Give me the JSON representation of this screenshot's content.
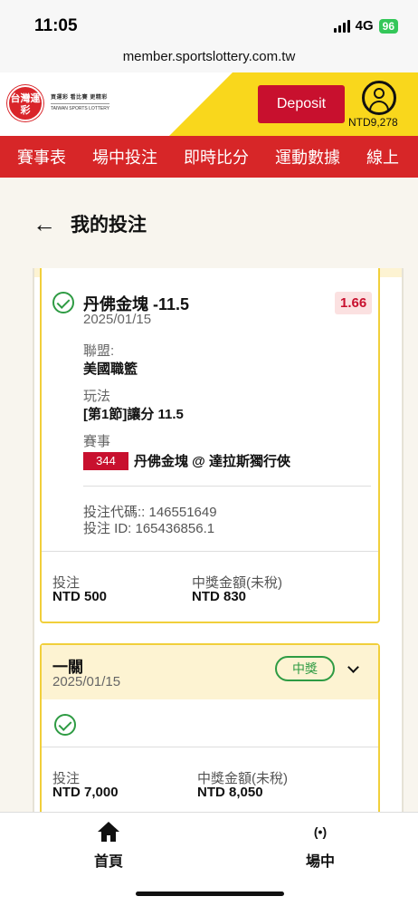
{
  "status_bar": {
    "time": "11:05",
    "network": "4G",
    "battery": "96"
  },
  "browser": {
    "url": "member.sportslottery.com.tw"
  },
  "header": {
    "logo_text": "台灣運彩",
    "logo_cn": "買運彩 看比賽 更精彩",
    "logo_en": "TAIWAN SPORTS LOTTERY",
    "deposit_label": "Deposit",
    "balance": "NTD9,278"
  },
  "nav": {
    "items": [
      "賽事表",
      "場中投注",
      "即時比分",
      "運動數據",
      "線上"
    ]
  },
  "page": {
    "back_label": "←",
    "title": "我的投注"
  },
  "bet1": {
    "selection": "丹佛金塊 -11.5",
    "date": "2025/01/15",
    "odds": "1.66",
    "league_label": "聯盟:",
    "league": "美國職籃",
    "market_label": "玩法",
    "market": "[第1節]讓分 11.5",
    "event_label": "賽事",
    "event_no": "344",
    "event_name": "丹佛金塊 @ 達拉斯獨行俠",
    "bet_code": "投注代碼:: 146551649",
    "bet_id": "投注 ID: 165436856.1",
    "stake_label": "投注",
    "stake": "NTD 500",
    "payout_label": "中獎金額(未稅)",
    "payout": "NTD 830"
  },
  "bet2": {
    "type": "一關",
    "date": "2025/01/15",
    "status": "中獎",
    "stake_label": "投注",
    "stake": "NTD 7,000",
    "payout_label": "中獎金額(未稅)",
    "payout": "NTD 8,050"
  },
  "bottom_nav": {
    "home_label": "首頁",
    "live_icon": "(•)",
    "live_label": "場中"
  }
}
